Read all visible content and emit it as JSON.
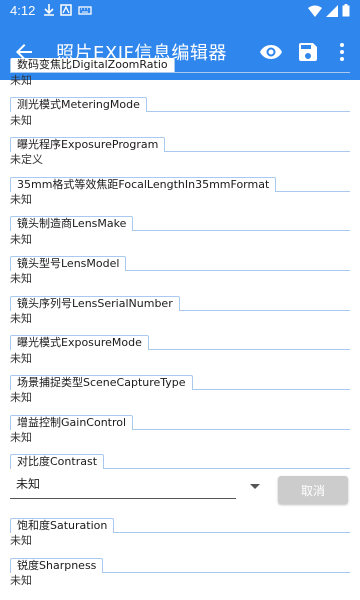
{
  "statusbar": {
    "time": "4:12"
  },
  "toolbar": {
    "title": "照片EXIF信息编辑器",
    "background": "#2f86ec"
  },
  "fields": [
    {
      "label": "数码变焦比DigitalZoomRatio",
      "value": "未知"
    },
    {
      "label": "测光模式MeteringMode",
      "value": "未知"
    },
    {
      "label": "曝光程序ExposureProgram",
      "value": "未定义"
    },
    {
      "label": "35mm格式等效焦距FocalLengthIn35mmFormat",
      "value": "未知"
    },
    {
      "label": "镜头制造商LensMake",
      "value": "未知"
    },
    {
      "label": "镜头型号LensModel",
      "value": "未知"
    },
    {
      "label": "镜头序列号LensSerialNumber",
      "value": "未知"
    },
    {
      "label": "曝光模式ExposureMode",
      "value": "未知"
    },
    {
      "label": "场景捕捉类型SceneCaptureType",
      "value": "未知"
    },
    {
      "label": "增益控制GainControl",
      "value": "未知"
    },
    {
      "label": "对比度Contrast",
      "value": ""
    },
    {
      "label": "饱和度Saturation",
      "value": "未知"
    },
    {
      "label": "锐度Sharpness",
      "value": "未知"
    }
  ],
  "contrast_editor": {
    "selected": "未知",
    "cancel_label": "取消"
  },
  "icons": {
    "back": "arrow-back-icon",
    "preview": "eye-icon",
    "save": "save-icon",
    "more": "more-vert-icon"
  }
}
